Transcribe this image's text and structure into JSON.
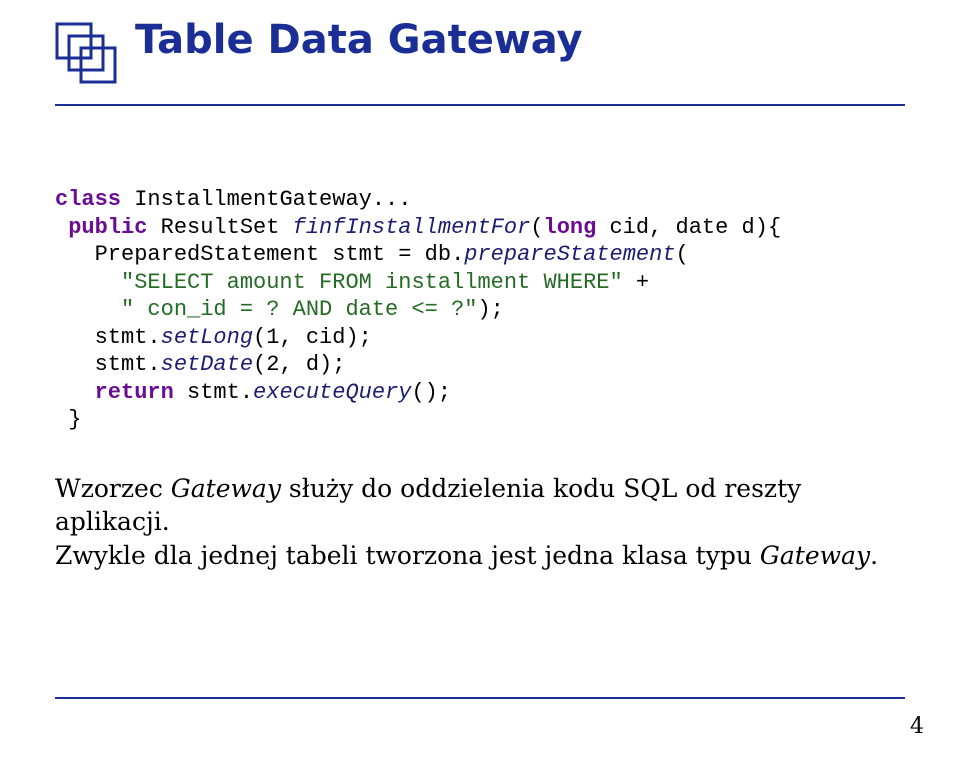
{
  "title": "Table Data Gateway",
  "code": {
    "l1_kw1": "class",
    "l1_rest": " InstallmentGateway...",
    "l2_kw1": "public",
    "l2_mid": " ResultSet ",
    "l2_fn": "finfInstallmentFor",
    "l2_paren": "(",
    "l2_kw2": "long",
    "l2_rest": " cid, date d){",
    "l3a": "   PreparedStatement stmt = db.",
    "l3fn": "prepareStatement",
    "l3b": "(",
    "l4_str": "     \"SELECT amount FROM installment WHERE\"",
    "l4_op": " +",
    "l5_str": "     \" con_id = ? AND date <= ?\"",
    "l5_end": ");",
    "l6a": "   stmt.",
    "l6fn": "setLong",
    "l6b": "(1, cid);",
    "l7a": "   stmt.",
    "l7fn": "setDate",
    "l7b": "(2, d);",
    "l8_kw": "   return",
    "l8_mid": " stmt.",
    "l8_fn": "executeQuery",
    "l8_end": "();",
    "l9": " }"
  },
  "paragraph": {
    "p1_a": "Wzorzec ",
    "p1_i": "Gateway",
    "p1_b": " służy do oddzielenia kodu SQL od reszty aplikacji.",
    "p2_a": "Zwykle dla jednej tabeli tworzona jest jedna klasa typu ",
    "p2_i": "Gateway",
    "p2_b": "."
  },
  "page_number": "4"
}
